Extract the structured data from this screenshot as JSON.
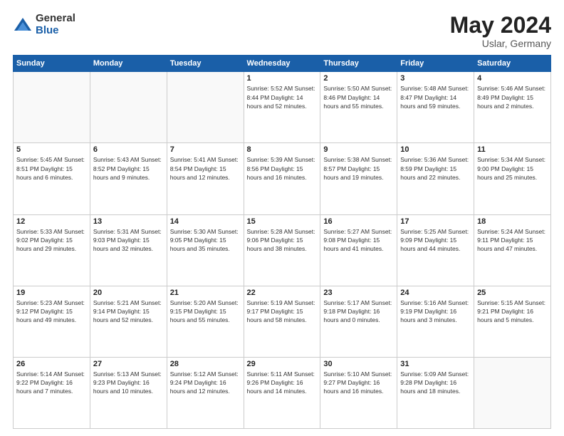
{
  "header": {
    "logo_general": "General",
    "logo_blue": "Blue",
    "title": "May 2024",
    "location": "Uslar, Germany"
  },
  "days_of_week": [
    "Sunday",
    "Monday",
    "Tuesday",
    "Wednesday",
    "Thursday",
    "Friday",
    "Saturday"
  ],
  "weeks": [
    [
      {
        "day": "",
        "info": ""
      },
      {
        "day": "",
        "info": ""
      },
      {
        "day": "",
        "info": ""
      },
      {
        "day": "1",
        "info": "Sunrise: 5:52 AM\nSunset: 8:44 PM\nDaylight: 14 hours\nand 52 minutes."
      },
      {
        "day": "2",
        "info": "Sunrise: 5:50 AM\nSunset: 8:46 PM\nDaylight: 14 hours\nand 55 minutes."
      },
      {
        "day": "3",
        "info": "Sunrise: 5:48 AM\nSunset: 8:47 PM\nDaylight: 14 hours\nand 59 minutes."
      },
      {
        "day": "4",
        "info": "Sunrise: 5:46 AM\nSunset: 8:49 PM\nDaylight: 15 hours\nand 2 minutes."
      }
    ],
    [
      {
        "day": "5",
        "info": "Sunrise: 5:45 AM\nSunset: 8:51 PM\nDaylight: 15 hours\nand 6 minutes."
      },
      {
        "day": "6",
        "info": "Sunrise: 5:43 AM\nSunset: 8:52 PM\nDaylight: 15 hours\nand 9 minutes."
      },
      {
        "day": "7",
        "info": "Sunrise: 5:41 AM\nSunset: 8:54 PM\nDaylight: 15 hours\nand 12 minutes."
      },
      {
        "day": "8",
        "info": "Sunrise: 5:39 AM\nSunset: 8:56 PM\nDaylight: 15 hours\nand 16 minutes."
      },
      {
        "day": "9",
        "info": "Sunrise: 5:38 AM\nSunset: 8:57 PM\nDaylight: 15 hours\nand 19 minutes."
      },
      {
        "day": "10",
        "info": "Sunrise: 5:36 AM\nSunset: 8:59 PM\nDaylight: 15 hours\nand 22 minutes."
      },
      {
        "day": "11",
        "info": "Sunrise: 5:34 AM\nSunset: 9:00 PM\nDaylight: 15 hours\nand 25 minutes."
      }
    ],
    [
      {
        "day": "12",
        "info": "Sunrise: 5:33 AM\nSunset: 9:02 PM\nDaylight: 15 hours\nand 29 minutes."
      },
      {
        "day": "13",
        "info": "Sunrise: 5:31 AM\nSunset: 9:03 PM\nDaylight: 15 hours\nand 32 minutes."
      },
      {
        "day": "14",
        "info": "Sunrise: 5:30 AM\nSunset: 9:05 PM\nDaylight: 15 hours\nand 35 minutes."
      },
      {
        "day": "15",
        "info": "Sunrise: 5:28 AM\nSunset: 9:06 PM\nDaylight: 15 hours\nand 38 minutes."
      },
      {
        "day": "16",
        "info": "Sunrise: 5:27 AM\nSunset: 9:08 PM\nDaylight: 15 hours\nand 41 minutes."
      },
      {
        "day": "17",
        "info": "Sunrise: 5:25 AM\nSunset: 9:09 PM\nDaylight: 15 hours\nand 44 minutes."
      },
      {
        "day": "18",
        "info": "Sunrise: 5:24 AM\nSunset: 9:11 PM\nDaylight: 15 hours\nand 47 minutes."
      }
    ],
    [
      {
        "day": "19",
        "info": "Sunrise: 5:23 AM\nSunset: 9:12 PM\nDaylight: 15 hours\nand 49 minutes."
      },
      {
        "day": "20",
        "info": "Sunrise: 5:21 AM\nSunset: 9:14 PM\nDaylight: 15 hours\nand 52 minutes."
      },
      {
        "day": "21",
        "info": "Sunrise: 5:20 AM\nSunset: 9:15 PM\nDaylight: 15 hours\nand 55 minutes."
      },
      {
        "day": "22",
        "info": "Sunrise: 5:19 AM\nSunset: 9:17 PM\nDaylight: 15 hours\nand 58 minutes."
      },
      {
        "day": "23",
        "info": "Sunrise: 5:17 AM\nSunset: 9:18 PM\nDaylight: 16 hours\nand 0 minutes."
      },
      {
        "day": "24",
        "info": "Sunrise: 5:16 AM\nSunset: 9:19 PM\nDaylight: 16 hours\nand 3 minutes."
      },
      {
        "day": "25",
        "info": "Sunrise: 5:15 AM\nSunset: 9:21 PM\nDaylight: 16 hours\nand 5 minutes."
      }
    ],
    [
      {
        "day": "26",
        "info": "Sunrise: 5:14 AM\nSunset: 9:22 PM\nDaylight: 16 hours\nand 7 minutes."
      },
      {
        "day": "27",
        "info": "Sunrise: 5:13 AM\nSunset: 9:23 PM\nDaylight: 16 hours\nand 10 minutes."
      },
      {
        "day": "28",
        "info": "Sunrise: 5:12 AM\nSunset: 9:24 PM\nDaylight: 16 hours\nand 12 minutes."
      },
      {
        "day": "29",
        "info": "Sunrise: 5:11 AM\nSunset: 9:26 PM\nDaylight: 16 hours\nand 14 minutes."
      },
      {
        "day": "30",
        "info": "Sunrise: 5:10 AM\nSunset: 9:27 PM\nDaylight: 16 hours\nand 16 minutes."
      },
      {
        "day": "31",
        "info": "Sunrise: 5:09 AM\nSunset: 9:28 PM\nDaylight: 16 hours\nand 18 minutes."
      },
      {
        "day": "",
        "info": ""
      }
    ]
  ]
}
